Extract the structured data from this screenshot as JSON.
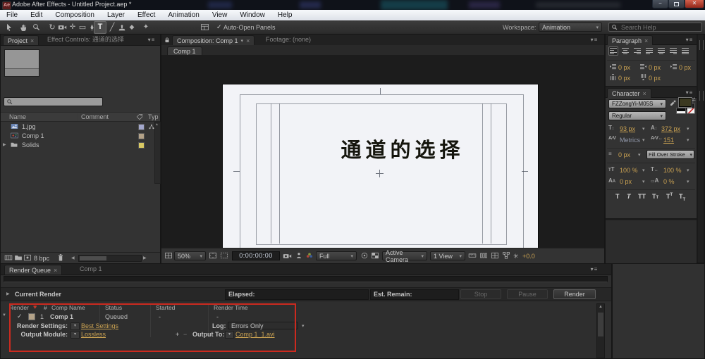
{
  "glyphs": {
    "close": "×",
    "check": "✓",
    "chevron": "▾",
    "tri_right": "▶",
    "tri_left": "◀",
    "tri_up": "▲",
    "twirl_open": "▼",
    "plus": "+",
    "minus": "−",
    "menu_lines": "≡",
    "heart": "♥",
    "rotate": "↻",
    "pan_behind": "✛",
    "rect_tool": "▭",
    "line_tool": "╱",
    "eraser_tool": "◆",
    "puppet_pin": "✦",
    "type_tool": "T",
    "tt": "TT",
    "updown": "↕",
    "leftright": "↔",
    "cap_a": "A",
    "av": "A∕V",
    "asterisk": "✳",
    "x_mark": "✕"
  },
  "titlebar": {
    "title": "Adobe After Effects - Untitled Project.aep *",
    "app_initials": "Ae"
  },
  "menubar": {
    "items": [
      "File",
      "Edit",
      "Composition",
      "Layer",
      "Effect",
      "Animation",
      "View",
      "Window",
      "Help"
    ]
  },
  "toolbar": {
    "auto_open_label": "Auto-Open Panels",
    "workspace_label": "Workspace:",
    "workspace_value": "Animation",
    "search_placeholder": "Search Help"
  },
  "project": {
    "tab_label": "Project",
    "effect_controls_label": "Effect Controls: 通道的选择",
    "columns": {
      "name": "Name",
      "comment": "Comment",
      "type": "Typ"
    },
    "items": [
      {
        "name": "1.jpg"
      },
      {
        "name": "Comp 1"
      },
      {
        "name": "Solids"
      }
    ],
    "bit_depth": "8 bpc"
  },
  "viewer": {
    "comp_tab": "Composition: Comp 1",
    "footage_tab": "Footage: (none)",
    "subtab": "Comp 1",
    "canvas_title": "通道的选择",
    "zoom": "50%",
    "timecode": "0:00:00:00",
    "resolution": "Full",
    "camera_view": "Active Camera",
    "view_layout": "1 View",
    "exposure": "+0.0"
  },
  "paragraph": {
    "tab_label": "Paragraph",
    "values": [
      "0 px",
      "0 px",
      "0 px",
      "0 px",
      "0 px"
    ]
  },
  "character": {
    "tab_label": "Character",
    "font_family": "FZZongYi-M05S",
    "font_style": "Regular",
    "font_size": "93 px",
    "leading": "372 px",
    "kerning": "Metrics",
    "tracking": "151",
    "stroke_width": "0 px",
    "stroke_mode": "Fill Over Stroke",
    "vertical_scale": "100 %",
    "horizontal_scale": "100 %",
    "baseline_shift": "0 px",
    "tsume": "0 %"
  },
  "render_queue": {
    "tab_label": "Render Queue",
    "comp_tab_label": "Comp 1",
    "current_render_label": "Current Render",
    "elapsed_label": "Elapsed:",
    "est_remain_label": "Est. Remain:",
    "stop_label": "Stop",
    "pause_label": "Pause",
    "render_label": "Render",
    "headers": {
      "render": "Render",
      "number": "#",
      "comp_name": "Comp Name",
      "status": "Status",
      "started": "Started",
      "render_time": "Render Time"
    },
    "row": {
      "number": "1",
      "comp_name": "Comp 1",
      "status": "Queued",
      "started": "-",
      "render_time": "-"
    },
    "render_settings_label": "Render Settings:",
    "render_settings_value": "Best Settings",
    "log_label": "Log:",
    "log_value": "Errors Only",
    "output_module_label": "Output Module:",
    "output_module_value": "Lossless",
    "output_to_label": "Output To:",
    "output_to_value": "Comp 1_1.avi"
  },
  "colors": {
    "accent_orange": "#c9a152",
    "annotation_red": "#cc2a1f",
    "swatch_jpg": "#a3a7cc",
    "swatch_comp": "#b3a288",
    "swatch_solids": "#d9c963",
    "canvas_white": "#f2f3f7"
  }
}
